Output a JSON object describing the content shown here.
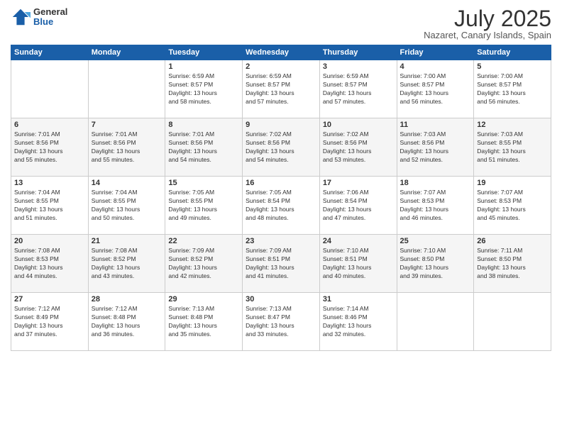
{
  "header": {
    "logo_general": "General",
    "logo_blue": "Blue",
    "month_title": "July 2025",
    "location": "Nazaret, Canary Islands, Spain"
  },
  "weekdays": [
    "Sunday",
    "Monday",
    "Tuesday",
    "Wednesday",
    "Thursday",
    "Friday",
    "Saturday"
  ],
  "weeks": [
    [
      {
        "day": "",
        "info": ""
      },
      {
        "day": "",
        "info": ""
      },
      {
        "day": "1",
        "info": "Sunrise: 6:59 AM\nSunset: 8:57 PM\nDaylight: 13 hours\nand 58 minutes."
      },
      {
        "day": "2",
        "info": "Sunrise: 6:59 AM\nSunset: 8:57 PM\nDaylight: 13 hours\nand 57 minutes."
      },
      {
        "day": "3",
        "info": "Sunrise: 6:59 AM\nSunset: 8:57 PM\nDaylight: 13 hours\nand 57 minutes."
      },
      {
        "day": "4",
        "info": "Sunrise: 7:00 AM\nSunset: 8:57 PM\nDaylight: 13 hours\nand 56 minutes."
      },
      {
        "day": "5",
        "info": "Sunrise: 7:00 AM\nSunset: 8:57 PM\nDaylight: 13 hours\nand 56 minutes."
      }
    ],
    [
      {
        "day": "6",
        "info": "Sunrise: 7:01 AM\nSunset: 8:56 PM\nDaylight: 13 hours\nand 55 minutes."
      },
      {
        "day": "7",
        "info": "Sunrise: 7:01 AM\nSunset: 8:56 PM\nDaylight: 13 hours\nand 55 minutes."
      },
      {
        "day": "8",
        "info": "Sunrise: 7:01 AM\nSunset: 8:56 PM\nDaylight: 13 hours\nand 54 minutes."
      },
      {
        "day": "9",
        "info": "Sunrise: 7:02 AM\nSunset: 8:56 PM\nDaylight: 13 hours\nand 54 minutes."
      },
      {
        "day": "10",
        "info": "Sunrise: 7:02 AM\nSunset: 8:56 PM\nDaylight: 13 hours\nand 53 minutes."
      },
      {
        "day": "11",
        "info": "Sunrise: 7:03 AM\nSunset: 8:56 PM\nDaylight: 13 hours\nand 52 minutes."
      },
      {
        "day": "12",
        "info": "Sunrise: 7:03 AM\nSunset: 8:55 PM\nDaylight: 13 hours\nand 51 minutes."
      }
    ],
    [
      {
        "day": "13",
        "info": "Sunrise: 7:04 AM\nSunset: 8:55 PM\nDaylight: 13 hours\nand 51 minutes."
      },
      {
        "day": "14",
        "info": "Sunrise: 7:04 AM\nSunset: 8:55 PM\nDaylight: 13 hours\nand 50 minutes."
      },
      {
        "day": "15",
        "info": "Sunrise: 7:05 AM\nSunset: 8:55 PM\nDaylight: 13 hours\nand 49 minutes."
      },
      {
        "day": "16",
        "info": "Sunrise: 7:05 AM\nSunset: 8:54 PM\nDaylight: 13 hours\nand 48 minutes."
      },
      {
        "day": "17",
        "info": "Sunrise: 7:06 AM\nSunset: 8:54 PM\nDaylight: 13 hours\nand 47 minutes."
      },
      {
        "day": "18",
        "info": "Sunrise: 7:07 AM\nSunset: 8:53 PM\nDaylight: 13 hours\nand 46 minutes."
      },
      {
        "day": "19",
        "info": "Sunrise: 7:07 AM\nSunset: 8:53 PM\nDaylight: 13 hours\nand 45 minutes."
      }
    ],
    [
      {
        "day": "20",
        "info": "Sunrise: 7:08 AM\nSunset: 8:53 PM\nDaylight: 13 hours\nand 44 minutes."
      },
      {
        "day": "21",
        "info": "Sunrise: 7:08 AM\nSunset: 8:52 PM\nDaylight: 13 hours\nand 43 minutes."
      },
      {
        "day": "22",
        "info": "Sunrise: 7:09 AM\nSunset: 8:52 PM\nDaylight: 13 hours\nand 42 minutes."
      },
      {
        "day": "23",
        "info": "Sunrise: 7:09 AM\nSunset: 8:51 PM\nDaylight: 13 hours\nand 41 minutes."
      },
      {
        "day": "24",
        "info": "Sunrise: 7:10 AM\nSunset: 8:51 PM\nDaylight: 13 hours\nand 40 minutes."
      },
      {
        "day": "25",
        "info": "Sunrise: 7:10 AM\nSunset: 8:50 PM\nDaylight: 13 hours\nand 39 minutes."
      },
      {
        "day": "26",
        "info": "Sunrise: 7:11 AM\nSunset: 8:50 PM\nDaylight: 13 hours\nand 38 minutes."
      }
    ],
    [
      {
        "day": "27",
        "info": "Sunrise: 7:12 AM\nSunset: 8:49 PM\nDaylight: 13 hours\nand 37 minutes."
      },
      {
        "day": "28",
        "info": "Sunrise: 7:12 AM\nSunset: 8:48 PM\nDaylight: 13 hours\nand 36 minutes."
      },
      {
        "day": "29",
        "info": "Sunrise: 7:13 AM\nSunset: 8:48 PM\nDaylight: 13 hours\nand 35 minutes."
      },
      {
        "day": "30",
        "info": "Sunrise: 7:13 AM\nSunset: 8:47 PM\nDaylight: 13 hours\nand 33 minutes."
      },
      {
        "day": "31",
        "info": "Sunrise: 7:14 AM\nSunset: 8:46 PM\nDaylight: 13 hours\nand 32 minutes."
      },
      {
        "day": "",
        "info": ""
      },
      {
        "day": "",
        "info": ""
      }
    ]
  ]
}
